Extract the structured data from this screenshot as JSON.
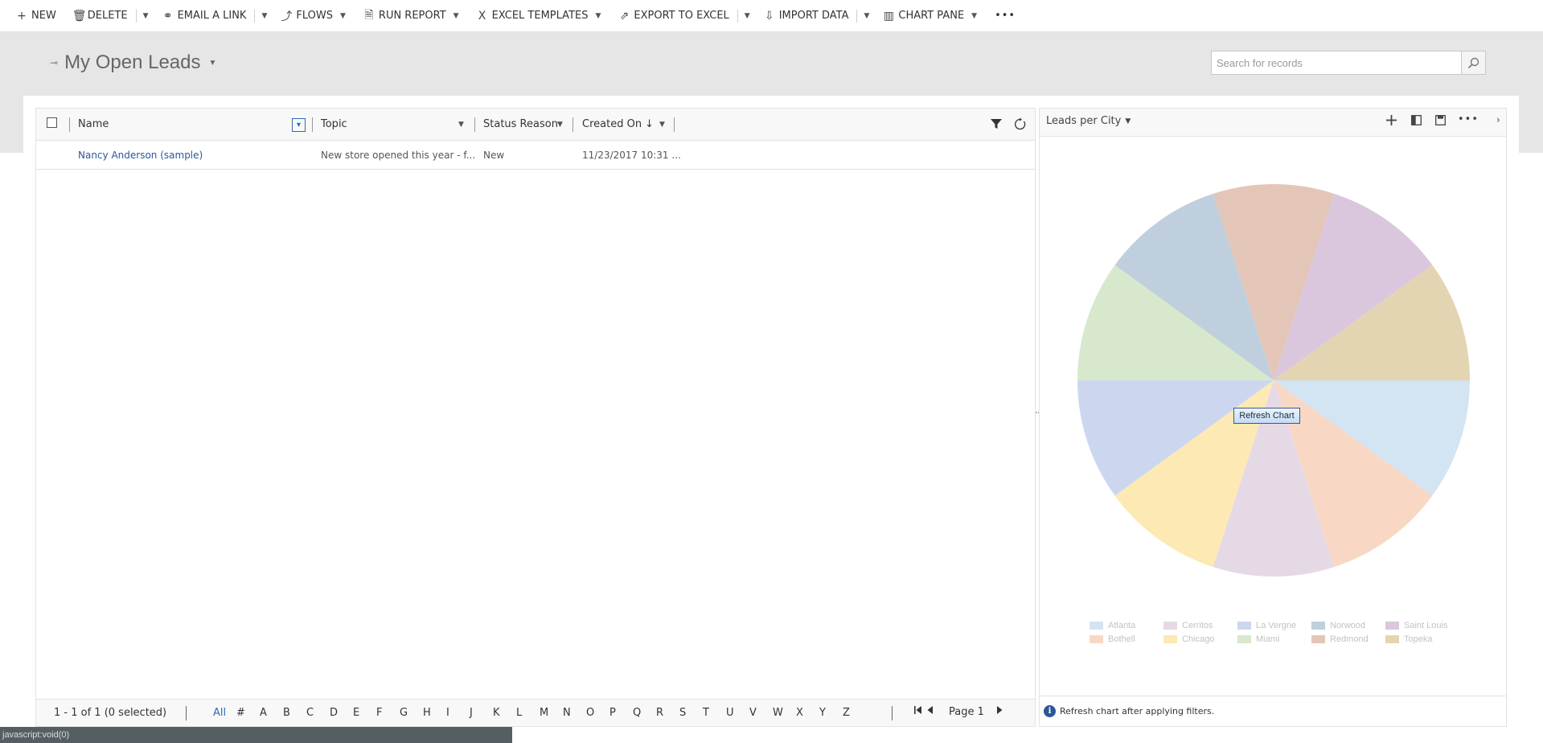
{
  "commandbar": {
    "new": "NEW",
    "delete": "DELETE",
    "email_link": "EMAIL A LINK",
    "flows": "FLOWS",
    "run_report": "RUN REPORT",
    "excel_templates": "EXCEL TEMPLATES",
    "export_excel": "EXPORT TO EXCEL",
    "import_data": "IMPORT DATA",
    "chart_pane": "CHART PANE",
    "more": "•••"
  },
  "view": {
    "title": "My Open Leads"
  },
  "search": {
    "placeholder": "Search for records"
  },
  "grid": {
    "columns": {
      "name": "Name",
      "topic": "Topic",
      "status_reason": "Status Reason",
      "created_on": "Created On"
    },
    "rows": [
      {
        "name": "Nancy Anderson (sample)",
        "topic": "New store opened this year - f...",
        "status_reason": "New",
        "created_on": "11/23/2017 10:31 ..."
      }
    ],
    "footer": {
      "count": "1 - 1 of 1 (0 selected)",
      "letters": [
        "All",
        "#",
        "A",
        "B",
        "C",
        "D",
        "E",
        "F",
        "G",
        "H",
        "I",
        "J",
        "K",
        "L",
        "M",
        "N",
        "O",
        "P",
        "Q",
        "R",
        "S",
        "T",
        "U",
        "V",
        "W",
        "X",
        "Y",
        "Z"
      ],
      "page": "Page 1"
    }
  },
  "chart": {
    "title": "Leads per City",
    "refresh_button": "Refresh Chart",
    "footer_note": "Refresh chart after applying filters."
  },
  "chart_data": {
    "type": "pie",
    "title": "Leads per City",
    "categories": [
      "Atlanta",
      "Bothell",
      "Cerritos",
      "Chicago",
      "La Vergne",
      "Miami",
      "Norwood",
      "Redmond",
      "Saint Louis",
      "Topeka"
    ],
    "values": [
      1,
      1,
      1,
      1,
      1,
      1,
      1,
      1,
      1,
      1
    ],
    "colors": [
      "#d3e4f3",
      "#f8d8c4",
      "#e6d9e6",
      "#fde9b3",
      "#ccd7ef",
      "#d8e8cc",
      "#bfcfdd",
      "#e4c6b8",
      "#dbc7dd",
      "#e3d5b1"
    ],
    "start_order": [
      "Atlanta",
      "Bothell",
      "Cerritos",
      "Chicago",
      "La Vergne",
      "Miami",
      "Norwood",
      "Redmond",
      "Saint Louis",
      "Topeka"
    ],
    "legend_position": "bottom"
  },
  "statusbar": {
    "text": "javascript:void(0)"
  }
}
